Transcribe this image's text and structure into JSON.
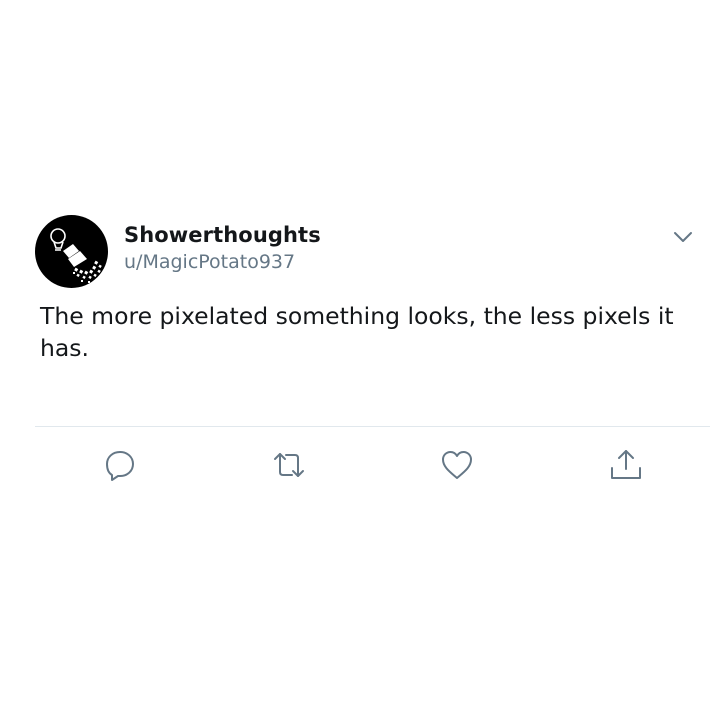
{
  "tweet": {
    "display_name": "Showerthoughts",
    "handle": "u/MagicPotato937",
    "text": "The more pixelated something looks, the less pixels it has."
  },
  "icons": {
    "avatar": "showerhead-lightbulb-logo",
    "menu": "chevron-down-icon",
    "reply": "reply-icon",
    "retweet": "retweet-icon",
    "like": "heart-icon",
    "share": "share-icon"
  },
  "colors": {
    "text": "#14171a",
    "secondary": "#657786",
    "icon": "#657786",
    "divider": "#e1e8ed",
    "avatar_bg": "#000000"
  }
}
